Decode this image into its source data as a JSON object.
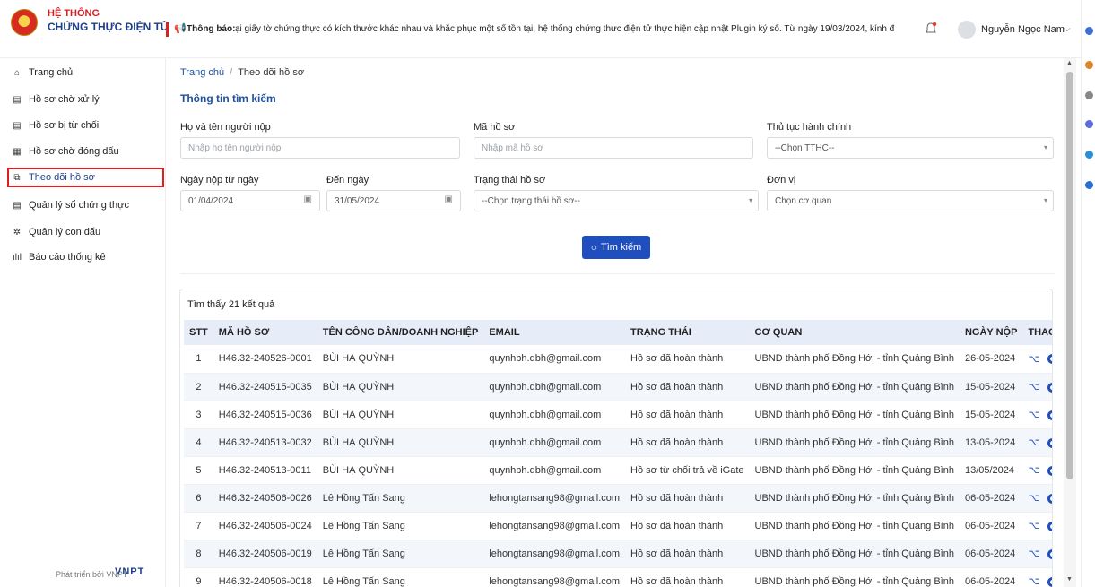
{
  "brand": {
    "line1": "HỆ THỐNG",
    "line2": "CHỨNG THỰC ĐIỆN TỬ"
  },
  "notice": {
    "title": "Thông báo:",
    "text": "ại giấy tờ chứng thực có kích thước khác nhau và khắc phục một số tồn tại, hệ thống chứng thực điện tử thực hiện cập nhật Plugin ký số. Từ ngày 19/03/2024, kính đ"
  },
  "user": {
    "name": "Nguyễn Ngọc Nam"
  },
  "sidebar": {
    "items": [
      {
        "label": "Trang chủ",
        "icon": "home-icon"
      },
      {
        "label": "Hồ sơ chờ xử lý",
        "icon": "document-icon"
      },
      {
        "label": "Hồ sơ bị từ chối",
        "icon": "document-icon"
      },
      {
        "label": "Hồ sơ chờ đóng dấu",
        "icon": "grid-icon"
      },
      {
        "label": "Theo dõi hồ sơ",
        "icon": "copy-icon"
      },
      {
        "label": "Quản lý sổ chứng thực",
        "icon": "document-icon"
      },
      {
        "label": "Quản lý con dấu",
        "icon": "gear-icon"
      },
      {
        "label": "Báo cáo thống kê",
        "icon": "bar-chart-icon"
      }
    ],
    "active_index": 4,
    "footer_text": "Phát triển bởi VNPT",
    "footer_logo": "VNPT"
  },
  "breadcrumb": {
    "home": "Trang chủ",
    "current": "Theo dõi hồ sơ"
  },
  "search": {
    "title": "Thông tin tìm kiếm",
    "submitter_label": "Họ và tên người nộp",
    "submitter_placeholder": "Nhập họ tên người nộp",
    "code_label": "Mã hồ sơ",
    "code_placeholder": "Nhập mã hồ sơ",
    "procedure_label": "Thủ tục hành chính",
    "procedure_value": "--Chọn TTHC--",
    "from_label": "Ngày nộp từ ngày",
    "from_value": "01/04/2024",
    "to_label": "Đến ngày",
    "to_value": "31/05/2024",
    "status_label": "Trạng thái hồ sơ",
    "status_value": "--Chọn trạng thái hồ sơ--",
    "unit_label": "Đơn vị",
    "unit_value": "Chọn cơ quan",
    "button_label": "Tìm kiếm"
  },
  "results": {
    "found_text": "Tìm thấy 21 kết quả",
    "columns": [
      "STT",
      "MÃ HỒ SƠ",
      "TÊN CÔNG DÂN/DOANH NGHIỆP",
      "EMAIL",
      "TRẠNG THÁI",
      "CƠ QUAN",
      "NGÀY NỘP",
      "THAO TÁC"
    ],
    "rows": [
      [
        "1",
        "H46.32-240526-0001",
        "BÙI HẠ QUỲNH",
        "quynhbh.qbh@gmail.com",
        "Hồ sơ đã hoàn thành",
        "UBND thành phố Đồng Hới - tỉnh Quảng Bình",
        "26-05-2024"
      ],
      [
        "2",
        "H46.32-240515-0035",
        "BÙI HẠ QUỲNH",
        "quynhbh.qbh@gmail.com",
        "Hồ sơ đã hoàn thành",
        "UBND thành phố Đồng Hới - tỉnh Quảng Bình",
        "15-05-2024"
      ],
      [
        "3",
        "H46.32-240515-0036",
        "BÙI HẠ QUỲNH",
        "quynhbh.qbh@gmail.com",
        "Hồ sơ đã hoàn thành",
        "UBND thành phố Đồng Hới - tỉnh Quảng Bình",
        "15-05-2024"
      ],
      [
        "4",
        "H46.32-240513-0032",
        "BÙI HẠ QUỲNH",
        "quynhbh.qbh@gmail.com",
        "Hồ sơ đã hoàn thành",
        "UBND thành phố Đồng Hới - tỉnh Quảng Bình",
        "13-05-2024"
      ],
      [
        "5",
        "H46.32-240513-0011",
        "BÙI HẠ QUỲNH",
        "quynhbh.qbh@gmail.com",
        "Hồ sơ từ chối trả về iGate",
        "UBND thành phố Đồng Hới - tỉnh Quảng Bình",
        "13/05/2024"
      ],
      [
        "6",
        "H46.32-240506-0026",
        "Lê Hồng Tấn Sang",
        "lehongtansang98@gmail.com",
        "Hồ sơ đã hoàn thành",
        "UBND thành phố Đồng Hới - tỉnh Quảng Bình",
        "06-05-2024"
      ],
      [
        "7",
        "H46.32-240506-0024",
        "Lê Hồng Tấn Sang",
        "lehongtansang98@gmail.com",
        "Hồ sơ đã hoàn thành",
        "UBND thành phố Đồng Hới - tỉnh Quảng Bình",
        "06-05-2024"
      ],
      [
        "8",
        "H46.32-240506-0019",
        "Lê Hồng Tấn Sang",
        "lehongtansang98@gmail.com",
        "Hồ sơ đã hoàn thành",
        "UBND thành phố Đồng Hới - tỉnh Quảng Bình",
        "06-05-2024"
      ],
      [
        "9",
        "H46.32-240506-0018",
        "Lê Hồng Tấn Sang",
        "lehongtansang98@gmail.com",
        "Hồ sơ đã hoàn thành",
        "UBND thành phố Đồng Hới - tỉnh Quảng Bình",
        "06-05-2024"
      ]
    ],
    "action_icons": [
      "workflow-icon",
      "eye-icon"
    ]
  },
  "colors": {
    "brand_red": "#d21f26",
    "brand_blue": "#1f3e8a",
    "primary": "#1f4fbf",
    "active_outline": "#e01e1e"
  }
}
